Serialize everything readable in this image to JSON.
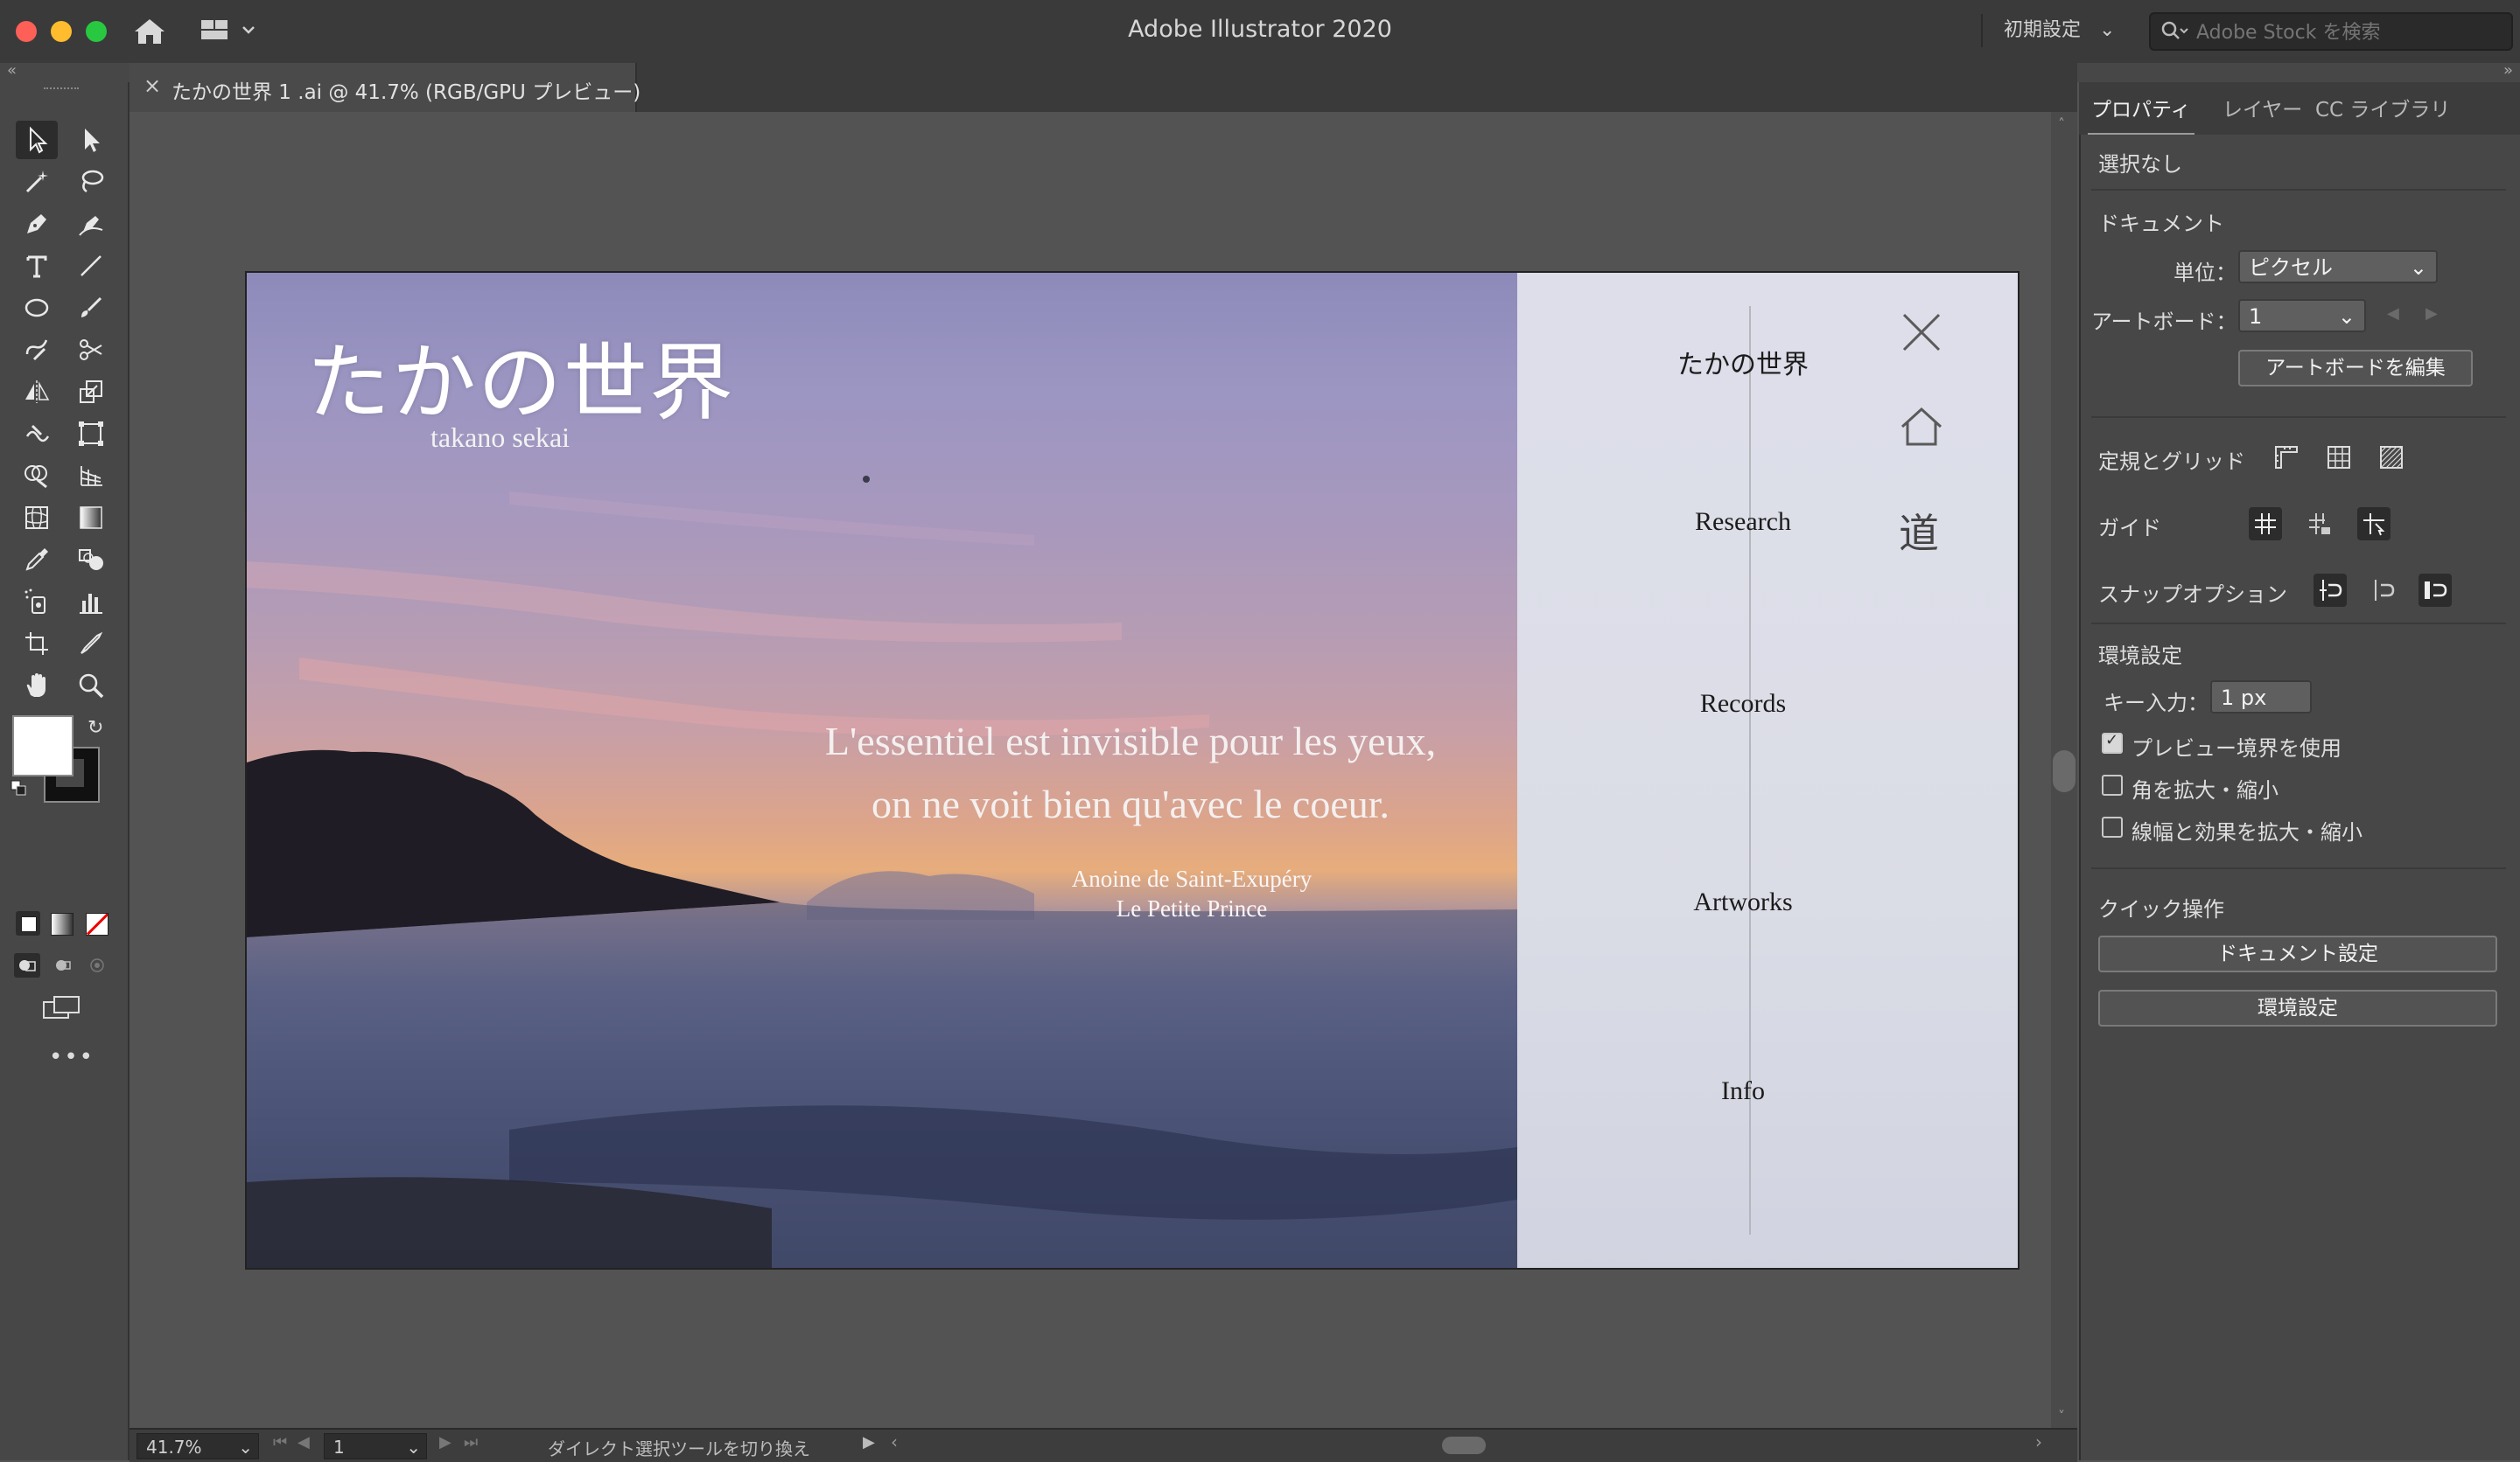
{
  "window": {
    "app_title": "Adobe Illustrator 2020",
    "workspace": "初期設定",
    "stock_search_placeholder": "Adobe Stock を検索"
  },
  "document_tab": {
    "close_glyph": "×",
    "title": "たかの世界 1 .ai @ 41.7% (RGB/GPU プレビュー)"
  },
  "artboard": {
    "site_title": "たかの世界",
    "site_subtitle": "takano sekai",
    "quote_line1": "L'essentiel est invisible pour les yeux,",
    "quote_line2": "on ne voit bien qu'avec le coeur.",
    "author_line1": "Anoine de Saint-Exupéry",
    "author_line2": "Le Petite Prince",
    "menu": [
      {
        "label": "たかの世界"
      },
      {
        "label": "Research"
      },
      {
        "label": "Records"
      },
      {
        "label": "Artworks"
      },
      {
        "label": "Info"
      }
    ],
    "michi_glyph": "道"
  },
  "status_bar": {
    "zoom": "41.7%",
    "artboard_number": "1",
    "message": "ダイレクト選択ツールを切り換え"
  },
  "properties_panel": {
    "tabs": [
      "プロパティ",
      "レイヤー",
      "CC ライブラリ"
    ],
    "selection_state": "選択なし",
    "document_section": "ドキュメント",
    "units_label": "単位：",
    "units_value": "ピクセル",
    "artboard_label": "アートボード：",
    "artboard_value": "1",
    "edit_artboard_button": "アートボードを編集",
    "rulers_grids_label": "定規とグリッド",
    "guides_label": "ガイド",
    "snap_label": "スナップオプション",
    "preferences_section": "環境設定",
    "keyboard_increment_label": "キー入力：",
    "keyboard_increment_value": "1 px",
    "checkboxes": [
      {
        "label": "プレビュー境界を使用",
        "checked": true
      },
      {
        "label": "角を拡大・縮小",
        "checked": false
      },
      {
        "label": "線幅と効果を拡大・縮小",
        "checked": false
      }
    ],
    "quick_actions_label": "クイック操作",
    "document_setup_button": "ドキュメント設定",
    "preferences_button": "環境設定"
  }
}
